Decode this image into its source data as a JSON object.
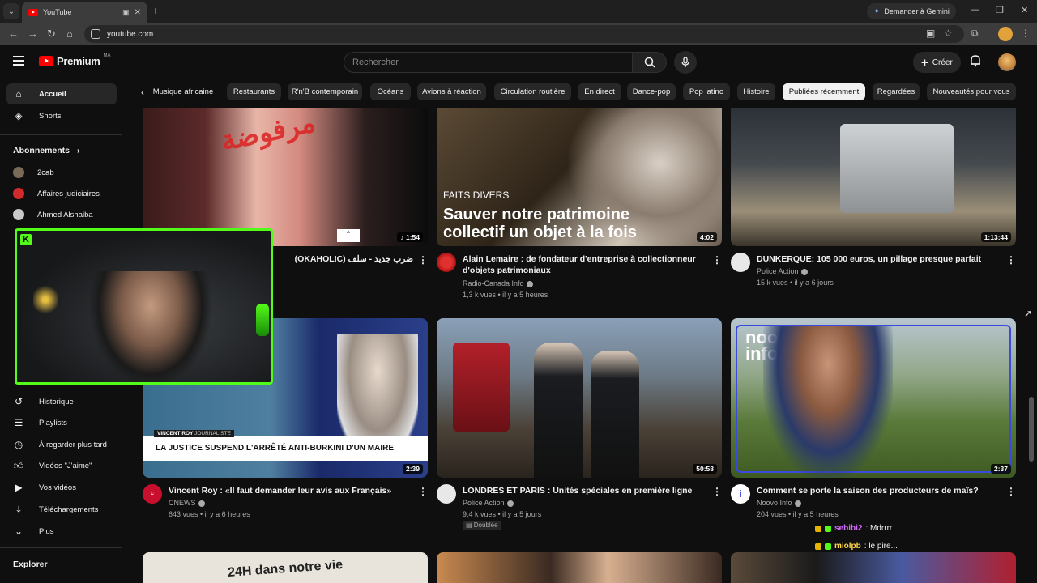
{
  "browser": {
    "tab_title": "YouTube",
    "gemini_label": "Demander à Gemini",
    "url": "youtube.com"
  },
  "header": {
    "logo_text": "Premium",
    "country_code": "MA",
    "search_placeholder": "Rechercher",
    "create_label": "Créer"
  },
  "chips": [
    "Musique africaine",
    "Restaurants",
    "R'n'B contemporain",
    "Océans",
    "Avions à réaction",
    "Circulation routière",
    "En direct",
    "Dance-pop",
    "Pop latino",
    "Histoire",
    "Publiées récemment",
    "Regardées",
    "Nouveautés pour vous"
  ],
  "chips_active": "Publiées récemment",
  "sidebar": {
    "home": "Accueil",
    "shorts": "Shorts",
    "subscriptions_header": "Abonnements",
    "subscriptions": [
      "2cab",
      "Affaires judiciaires",
      "Ahmed Alshaiba"
    ],
    "you_items": [
      "Historique",
      "Playlists",
      "À regarder plus tard",
      "Vidéos \"J'aime\"",
      "Vos vidéos",
      "Téléchargements",
      "Plus"
    ],
    "explore_header": "Explorer"
  },
  "videos": [
    {
      "title": "(OKAHOLIC) ضرب جديد - سلف",
      "duration": "1:54",
      "overlay_text": "مرفوضة"
    },
    {
      "title": "Alain Lemaire : de fondateur d'entreprise à collectionneur d'objets patrimoniaux",
      "channel": "Radio-Canada Info",
      "meta": "1,3 k vues • il y a 5 heures",
      "duration": "4:02",
      "overlay_kicker": "FAITS DIVERS",
      "overlay_title": "Sauver notre patrimoine collectif un objet à la fois"
    },
    {
      "title": "DUNKERQUE: 105 000 euros, un pillage presque parfait",
      "channel": "Police Action",
      "meta": "15 k vues • il y a 6 jours",
      "duration": "1:13:44"
    },
    {
      "title": "Vincent Roy : «Il faut demander leur avis aux Français»",
      "channel": "CNEWS",
      "meta": "643 vues • il y a 6 heures",
      "duration": "2:39",
      "overlay_name": "VINCENT ROY",
      "overlay_role": "JOURNALISTE",
      "overlay_headline": "LA JUSTICE SUSPEND L'ARRÊTÉ ANTI-BURKINI D'UN MAIRE"
    },
    {
      "title": "LONDRES ET PARIS : Unités spéciales en première ligne",
      "channel": "Police Action",
      "meta": "9,4 k vues • il y a 5 jours",
      "duration": "50:58",
      "badge": "Doublée"
    },
    {
      "title": "Comment se porte la saison des producteurs de maïs?",
      "channel": "Noovo Info",
      "meta": "204 vues • il y a 5 heures",
      "duration": "2:37",
      "overlay_brand": "noovo info"
    }
  ],
  "row3_overlay": "24H dans notre vie",
  "chat": [
    {
      "user": "sebibi2",
      "message": ": Mdrrrr"
    },
    {
      "user": "miolpb",
      "message": ": le pire..."
    }
  ]
}
